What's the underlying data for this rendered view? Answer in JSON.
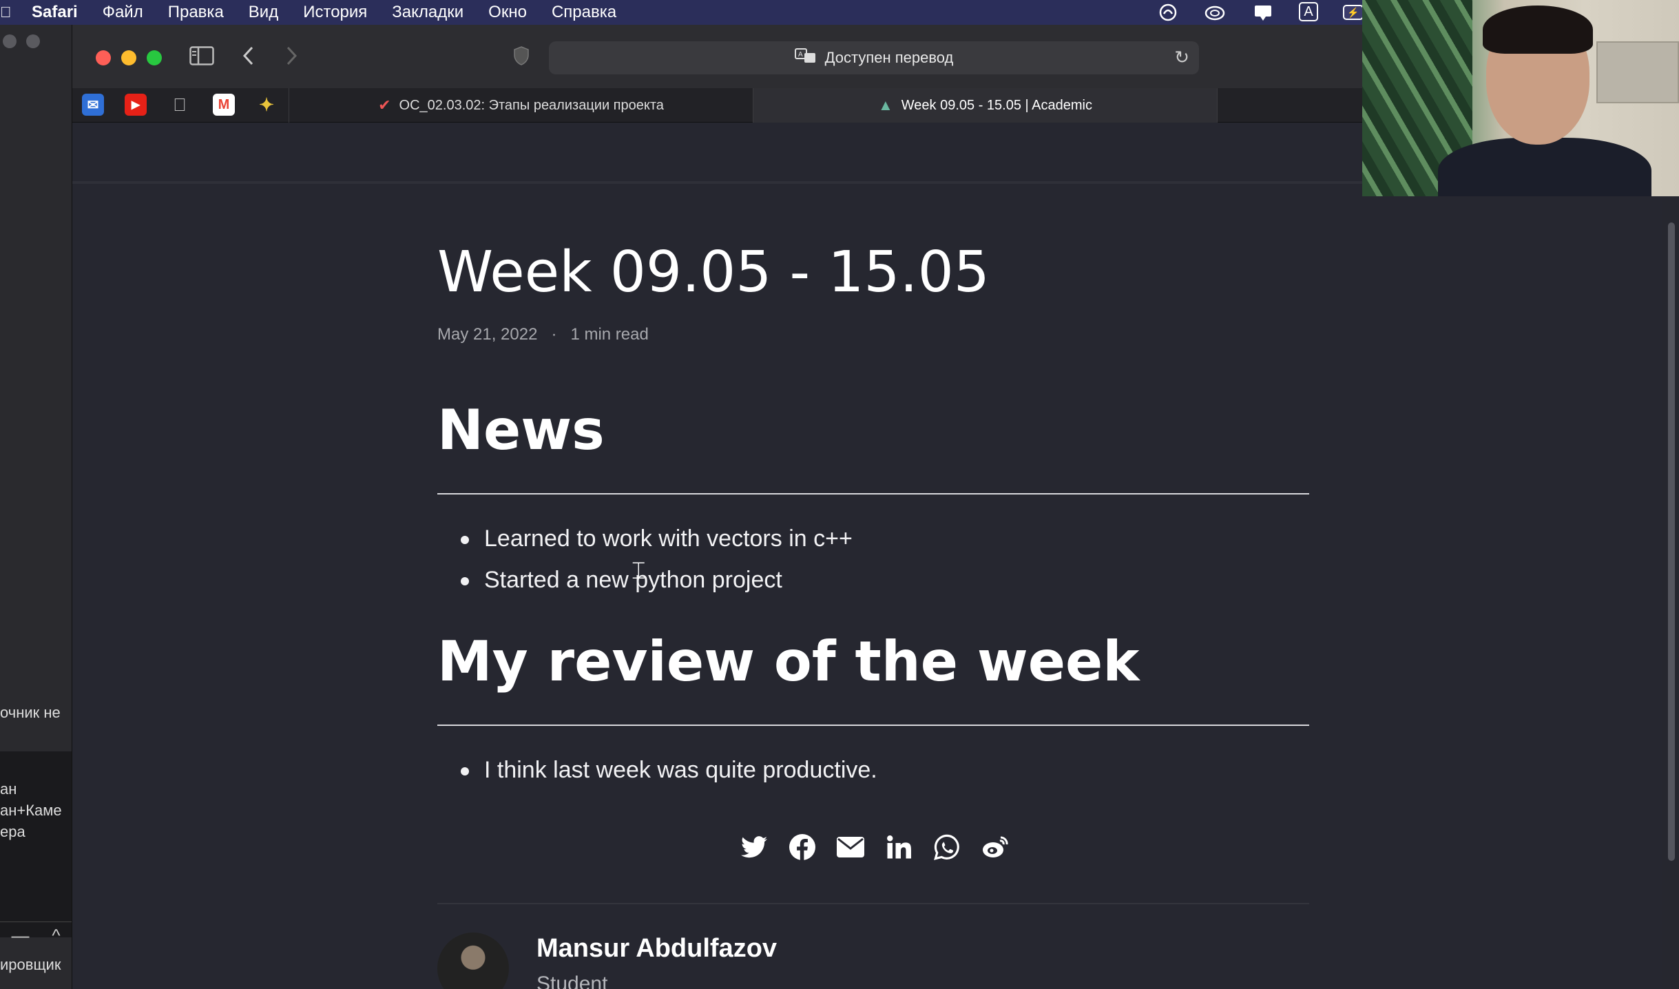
{
  "menubar": {
    "apple_icon": "apple-logo-icon",
    "items": [
      "Safari",
      "Файл",
      "Правка",
      "Вид",
      "История",
      "Закладки",
      "Окно",
      "Справка"
    ],
    "status_icons": [
      "creative-cloud-icon",
      "creative-cloud-alt-icon",
      "notification-icon",
      "input-source-icon",
      "battery-icon"
    ],
    "input_source": "A"
  },
  "background_window": {
    "texts": [
      "очник не",
      "ан",
      "ан+Каме",
      "ера",
      "ировщик"
    ],
    "bottom_controls": [
      "—",
      "^"
    ]
  },
  "safari": {
    "address_text": "Доступен перевод",
    "bookmark_favicons": [
      "mail-icon",
      "youtube-icon",
      "apple-icon",
      "gmail-icon",
      "star-app-icon"
    ],
    "tabs": [
      {
        "label": "ОС_02.03.02: Этапы реализации проекта",
        "icon": "course-icon",
        "active": false
      },
      {
        "label": "Week 09.05 - 15.05 | Academic",
        "icon": "academic-icon",
        "active": true
      },
      {
        "label": "",
        "icon": "google-icon",
        "active": false
      }
    ]
  },
  "page": {
    "title": "Week 09.05 - 15.05",
    "date": "May 21, 2022",
    "separator": "·",
    "read_time": "1 min read",
    "sections": [
      {
        "heading": "News",
        "bullets": [
          "Learned to work with vectors in c++",
          "Started a new python project"
        ]
      },
      {
        "heading": "My review of the week",
        "bullets": [
          "I think last week was quite productive."
        ]
      }
    ],
    "share_icons": [
      "twitter-icon",
      "facebook-icon",
      "email-icon",
      "linkedin-icon",
      "whatsapp-icon",
      "weibo-icon"
    ],
    "author": {
      "name": "Mansur Abdulfazov",
      "role": "Student"
    }
  },
  "colors": {
    "menubar": "#2b2e5a",
    "page_bg": "#262730",
    "text": "#ffffff",
    "meta_text": "#a7a8ad"
  }
}
